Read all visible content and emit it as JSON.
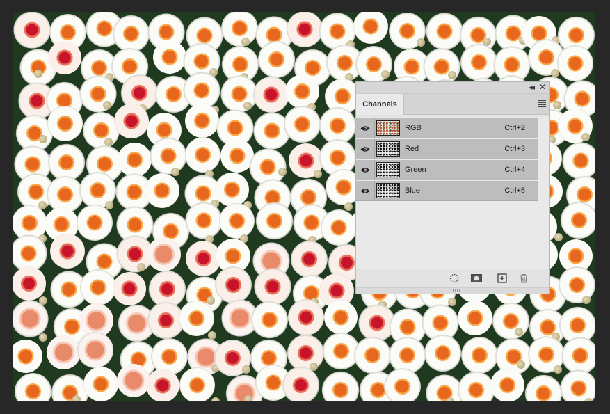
{
  "panel": {
    "tab_label": "Channels",
    "collapse_icon": "double-chevron-left-icon",
    "close_icon": "close-icon",
    "menu_icon": "panel-menu-icon",
    "channels": [
      {
        "name": "RGB",
        "shortcut": "Ctrl+2",
        "visible": true
      },
      {
        "name": "Red",
        "shortcut": "Ctrl+3",
        "visible": true
      },
      {
        "name": "Green",
        "shortcut": "Ctrl+4",
        "visible": true
      },
      {
        "name": "Blue",
        "shortcut": "Ctrl+5",
        "visible": true
      }
    ],
    "footer_tools": [
      "load-channel-as-selection-icon",
      "save-selection-as-channel-icon",
      "create-new-channel-icon",
      "delete-channel-icon"
    ]
  },
  "colors": {
    "workspace_bg": "#272727",
    "panel_bg": "#e3e3e3",
    "row_selected_bg": "#bdbdbd",
    "text": "#1c1c1c"
  }
}
